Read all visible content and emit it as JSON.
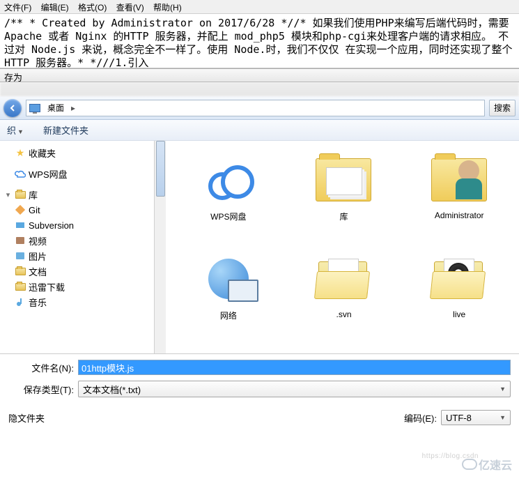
{
  "menu": {
    "file": "文件(F)",
    "edit": "编辑(E)",
    "format": "格式(O)",
    "view": "查看(V)",
    "help": "帮助(H)"
  },
  "editor_text": "/** * Created by Administrator on 2017/6/28 *//* 如果我们使用PHP来编写后端代码时，需要Apache 或者 Nginx 的HTTP 服务器，并配上 mod_php5 模块和php-cgi来处理客户端的请求相应。 不过对 Node.js 来说，概念完全不一样了。使用 Node.时，我们不仅仅 在实现一个应用，同时还实现了整个 HTTP 服务器。* *///1.引入",
  "dialog_title": "存为",
  "location": {
    "base": "桌面"
  },
  "search_btn": "搜索",
  "toolbar": {
    "organize": "织",
    "newfolder": "新建文件夹"
  },
  "sidebar": {
    "favorites": "收藏夹",
    "wps": "WPS网盘",
    "library": "库",
    "items": [
      "Git",
      "Subversion",
      "视频",
      "图片",
      "文档",
      "迅雷下载",
      "音乐"
    ]
  },
  "grid": {
    "wps": "WPS网盘",
    "lib": "库",
    "admin": "Administrator",
    "net": "网络",
    "svn": ".svn",
    "live": "live"
  },
  "filename_label": "文件名(N):",
  "filename_value": "01http模块.js",
  "savetype_label": "保存类型(T):",
  "savetype_value": "文本文档(*.txt)",
  "hidden_folders": "隐文件夹",
  "encoding_label": "编码(E):",
  "encoding_value": "UTF-8",
  "watermark": "亿速云"
}
